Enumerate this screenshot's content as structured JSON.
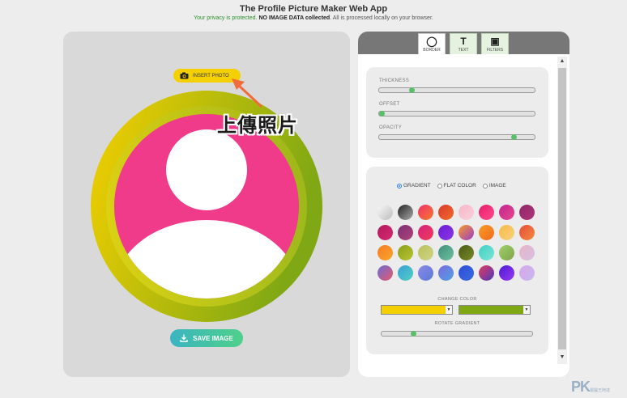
{
  "header": {
    "title": "The Profile Picture Maker Web App",
    "privacy_lead": "Your privacy is protected.",
    "privacy_bold": "NO IMAGE DATA collected",
    "privacy_rest": ". All is processed locally on your browser."
  },
  "editor": {
    "insert_label": "INSERT PHOTO",
    "annotation": "上傳照片",
    "save_label": "SAVE IMAGE"
  },
  "tabs": [
    {
      "label": "BORDER",
      "icon": "circle-icon"
    },
    {
      "label": "TEXT",
      "icon": "text-icon"
    },
    {
      "label": "FILTERS",
      "icon": "image-filter-icon"
    }
  ],
  "border_settings": {
    "thickness_label": "THICKNESS",
    "offset_label": "OFFSET",
    "opacity_label": "OPACITY",
    "thickness_value": 0.2,
    "offset_value": 0.0,
    "opacity_value": 0.88
  },
  "fill": {
    "options": [
      "GRADIENT",
      "FLAT COLOR",
      "IMAGE"
    ],
    "selected": "GRADIENT",
    "change_color_label": "CHANGE COLOR",
    "color1": "#f5d000",
    "color2": "#7fa814",
    "rotate_label": "ROTATE GRADIENT",
    "rotate_value": 0.2
  },
  "swatches": [
    "linear-gradient(135deg,#fafafa,#bdbdbd)",
    "linear-gradient(135deg,#222,#aaa)",
    "linear-gradient(135deg,#f0306a,#f47a2b)",
    "linear-gradient(135deg,#d93b2b,#f06a2b)",
    "linear-gradient(135deg,#f7b6c8,#f9d1dc)",
    "linear-gradient(135deg,#e81c6b,#ff4d8d)",
    "linear-gradient(135deg,#c2258f,#e6478e)",
    "linear-gradient(135deg,#8e2766,#b0347a)",
    "linear-gradient(135deg,#b11a5e,#d6286f)",
    "linear-gradient(135deg,#7b2f76,#b04478)",
    "linear-gradient(135deg,#d8207d,#ee3d5b)",
    "linear-gradient(135deg,#6a1fd1,#8a35e6)",
    "linear-gradient(135deg,#f79b27,#9c3bc9)",
    "linear-gradient(135deg,#f79b27,#f26b1d)",
    "linear-gradient(135deg,#f7b94a,#f7d27a)",
    "linear-gradient(135deg,#e64e3a,#f28a3f)",
    "linear-gradient(135deg,#f57c24,#f9a62b)",
    "linear-gradient(135deg,#8a9f1a,#b9c431)",
    "linear-gradient(135deg,#b9c25a,#d0d388)",
    "linear-gradient(135deg,#3f8f7a,#6ec0a0)",
    "linear-gradient(135deg,#4a5a14,#7a8a28)",
    "linear-gradient(135deg,#3fd0c5,#7de5d5)",
    "linear-gradient(135deg,#9fcf6a,#7fa44a)",
    "linear-gradient(135deg,#e6b5c8,#d8c0e0)",
    "linear-gradient(135deg,#6a6bd6,#e65a6a)",
    "linear-gradient(135deg,#3a9fd6,#4fd0c5)",
    "linear-gradient(135deg,#8a8ae6,#5a7ad6)",
    "linear-gradient(135deg,#7a6be0,#4fa0e0)",
    "linear-gradient(135deg,#2a4fd6,#3a6ae0)",
    "linear-gradient(135deg,#e63a5a,#4a3ac0)",
    "linear-gradient(135deg,#4a1ad6,#9a3af0)",
    "linear-gradient(135deg,#d6a8e8,#c8b8f0)"
  ],
  "watermark": {
    "main": "PK",
    "sub": "電腦王阿達"
  }
}
